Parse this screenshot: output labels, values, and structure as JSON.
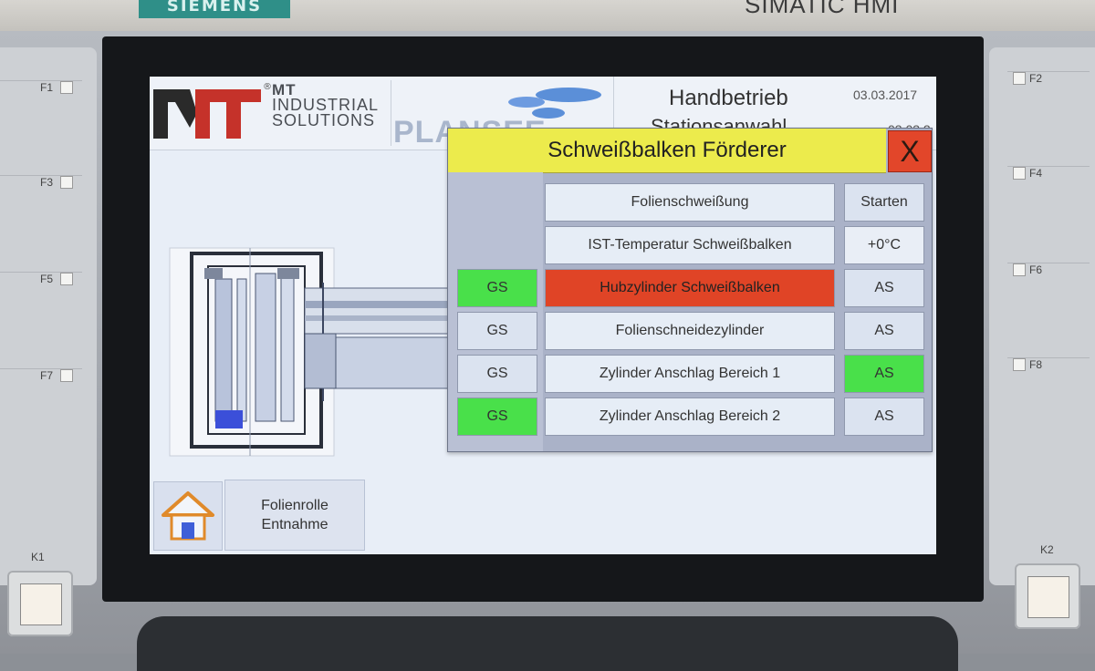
{
  "device": {
    "brand_left": "SIEMENS",
    "brand_right": "SIMATIC HMI",
    "fkeys_left": [
      "F1",
      "F3",
      "F5",
      "F7"
    ],
    "fkeys_right": [
      "F2",
      "F4",
      "F6",
      "F8"
    ],
    "kkeys": [
      "K1",
      "K2"
    ]
  },
  "header": {
    "logo": {
      "line1": "MT",
      "line2": "INDUSTRIAL",
      "line3": "SOLUTIONS",
      "registered": "®"
    },
    "partner_logo": "PLANSEE",
    "mode": "Handbetrieb",
    "subtitle": "Stationsanwahl",
    "date": "03.03.2017",
    "date_partial": "03.03.2"
  },
  "bottom": {
    "home_icon": "home-icon",
    "roll_line1": "Folienrolle",
    "roll_line2": "Entnahme"
  },
  "popup": {
    "title": "Schweißbalken Förderer",
    "close_label": "X",
    "rows": [
      {
        "label": "Folienschweißung",
        "gs": null,
        "right": "Starten",
        "label_state": "normal",
        "gs_state": null,
        "right_state": "button"
      },
      {
        "label": "IST-Temperatur Schweißbalken",
        "gs": null,
        "right": "+0°C",
        "label_state": "normal",
        "gs_state": null,
        "right_state": "value"
      },
      {
        "label": "Hubzylinder Schweißbalken",
        "gs": "GS",
        "right": "AS",
        "label_state": "alarm",
        "gs_state": "active",
        "right_state": "button"
      },
      {
        "label": "Folienschneidezylinder",
        "gs": "GS",
        "right": "AS",
        "label_state": "normal",
        "gs_state": "inactive",
        "right_state": "button"
      },
      {
        "label": "Zylinder Anschlag Bereich 1",
        "gs": "GS",
        "right": "AS",
        "label_state": "normal",
        "gs_state": "inactive",
        "right_state": "active"
      },
      {
        "label": "Zylinder Anschlag Bereich 2",
        "gs": "GS",
        "right": "AS",
        "label_state": "normal",
        "gs_state": "active",
        "right_state": "button"
      }
    ]
  },
  "colors": {
    "title_bar": "#eceb4c",
    "close": "#e2462a",
    "alarm": "#e04426",
    "active": "#49e04a",
    "panel": "#aab2c8"
  }
}
